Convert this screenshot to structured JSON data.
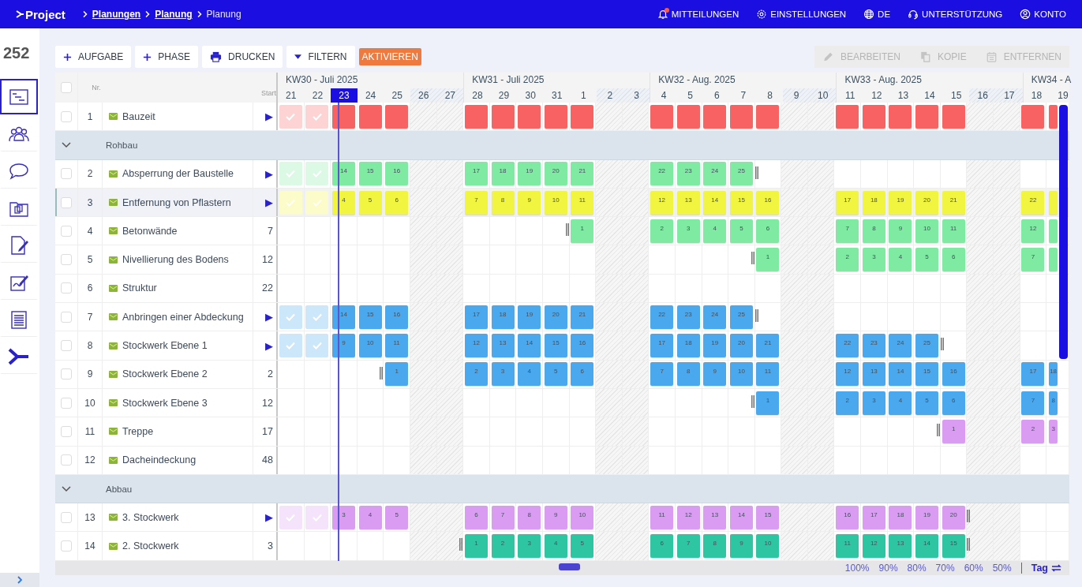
{
  "topbar": {
    "logo": "Project",
    "breadcrumbs": [
      {
        "label": "Planungen",
        "current": false
      },
      {
        "label": "Planung",
        "current": false
      },
      {
        "label": "Planung",
        "current": true
      }
    ],
    "nav": [
      {
        "kind": "notifications",
        "label": "MITTEILUNGEN",
        "unread": true
      },
      {
        "kind": "settings",
        "label": "EINSTELLUNGEN"
      },
      {
        "kind": "language",
        "label": "DE"
      },
      {
        "kind": "support",
        "label": "UNTERSTÜTZUNG"
      },
      {
        "kind": "account",
        "label": "KONTO"
      }
    ]
  },
  "sidebar": {
    "count": "252",
    "items": [
      {
        "selected": true
      },
      {
        "selected": false
      },
      {
        "selected": false
      },
      {
        "selected": false
      },
      {
        "selected": false
      },
      {
        "selected": false
      },
      {
        "selected": false
      },
      {
        "selected": false
      }
    ]
  },
  "toolbar": {
    "left": [
      {
        "kind": "add",
        "label": "AUFGABE",
        "disabled": false
      },
      {
        "kind": "add",
        "label": "PHASE",
        "disabled": false
      },
      {
        "kind": "print",
        "label": "DRUCKEN",
        "disabled": false
      },
      {
        "kind": "filter",
        "label": "FILTERN",
        "disabled": false
      },
      {
        "kind": "accent",
        "label": "AKTIVIEREN",
        "disabled": false
      }
    ],
    "right": [
      {
        "kind": "edit",
        "label": "BEARBEITEN",
        "disabled": true
      },
      {
        "kind": "copy",
        "label": "KOPIE",
        "disabled": true
      },
      {
        "kind": "delete",
        "label": "ENTFERNEN",
        "disabled": true
      }
    ]
  },
  "table": {
    "header": {
      "checked": false,
      "nr": "Nr.",
      "start": "Start"
    },
    "weeks": [
      {
        "label": "KW30 - Juli 2025",
        "days": [
          {
            "label": "21",
            "weekend": false,
            "selected": false
          },
          {
            "label": "22",
            "weekend": false,
            "selected": false
          },
          {
            "label": "23",
            "weekend": false,
            "selected": true
          },
          {
            "label": "24",
            "weekend": false,
            "selected": false
          },
          {
            "label": "25",
            "weekend": false,
            "selected": false
          },
          {
            "label": "26",
            "weekend": true,
            "selected": false
          },
          {
            "label": "27",
            "weekend": true,
            "selected": false
          }
        ]
      },
      {
        "label": "KW31 - Juli 2025",
        "days": [
          {
            "label": "28",
            "weekend": false,
            "selected": false
          },
          {
            "label": "29",
            "weekend": false,
            "selected": false
          },
          {
            "label": "30",
            "weekend": false,
            "selected": false
          },
          {
            "label": "31",
            "weekend": false,
            "selected": false
          },
          {
            "label": "1",
            "weekend": false,
            "selected": false
          },
          {
            "label": "2",
            "weekend": true,
            "selected": false
          },
          {
            "label": "3",
            "weekend": true,
            "selected": false
          }
        ]
      },
      {
        "label": "KW32 - Aug. 2025",
        "days": [
          {
            "label": "4",
            "weekend": false,
            "selected": false
          },
          {
            "label": "5",
            "weekend": false,
            "selected": false
          },
          {
            "label": "6",
            "weekend": false,
            "selected": false
          },
          {
            "label": "7",
            "weekend": false,
            "selected": false
          },
          {
            "label": "8",
            "weekend": false,
            "selected": false
          },
          {
            "label": "9",
            "weekend": true,
            "selected": false
          },
          {
            "label": "10",
            "weekend": true,
            "selected": false
          }
        ]
      },
      {
        "label": "KW33 - Aug. 2025",
        "days": [
          {
            "label": "11",
            "weekend": false,
            "selected": false
          },
          {
            "label": "12",
            "weekend": false,
            "selected": false
          },
          {
            "label": "13",
            "weekend": false,
            "selected": false
          },
          {
            "label": "14",
            "weekend": false,
            "selected": false
          },
          {
            "label": "15",
            "weekend": false,
            "selected": false
          },
          {
            "label": "16",
            "weekend": true,
            "selected": false
          },
          {
            "label": "17",
            "weekend": true,
            "selected": false
          }
        ]
      },
      {
        "label": "KW34 - A",
        "days": [
          {
            "label": "18",
            "weekend": false,
            "selected": false
          },
          {
            "label": "19",
            "weekend": false,
            "selected": false
          }
        ]
      }
    ],
    "rows": [
      {
        "kind": "task",
        "nr": "1",
        "name": "Bauzeit",
        "start": "▶",
        "checked": false,
        "selected": false,
        "color": "#f86262",
        "cells": [
          {
            "kind": "done"
          },
          {
            "kind": "done"
          },
          {
            "kind": "bar"
          },
          {
            "kind": "bar"
          },
          {
            "kind": "bar"
          },
          {
            "kind": "empty"
          },
          {
            "kind": "empty"
          },
          {
            "kind": "bar"
          },
          {
            "kind": "bar"
          },
          {
            "kind": "bar"
          },
          {
            "kind": "bar"
          },
          {
            "kind": "bar"
          },
          {
            "kind": "empty"
          },
          {
            "kind": "empty"
          },
          {
            "kind": "bar"
          },
          {
            "kind": "bar"
          },
          {
            "kind": "bar"
          },
          {
            "kind": "bar"
          },
          {
            "kind": "bar"
          },
          {
            "kind": "empty"
          },
          {
            "kind": "empty"
          },
          {
            "kind": "bar"
          },
          {
            "kind": "bar"
          },
          {
            "kind": "bar"
          },
          {
            "kind": "bar"
          },
          {
            "kind": "bar"
          },
          {
            "kind": "empty"
          },
          {
            "kind": "empty"
          },
          {
            "kind": "bar"
          },
          {
            "kind": "bar"
          }
        ]
      },
      {
        "kind": "group",
        "label": "Rohbau",
        "expanded": true
      },
      {
        "kind": "task",
        "nr": "2",
        "name": "Absperrung der Baustelle",
        "start": "▶",
        "checked": false,
        "selected": false,
        "color": "#7eeaa2",
        "cells": [
          {
            "kind": "done"
          },
          {
            "kind": "done"
          },
          {
            "kind": "bar",
            "label": "14"
          },
          {
            "kind": "bar",
            "label": "15"
          },
          {
            "kind": "bar",
            "label": "16"
          },
          {
            "kind": "empty"
          },
          {
            "kind": "empty"
          },
          {
            "kind": "bar",
            "label": "17"
          },
          {
            "kind": "bar",
            "label": "18"
          },
          {
            "kind": "bar",
            "label": "19"
          },
          {
            "kind": "bar",
            "label": "20"
          },
          {
            "kind": "bar",
            "label": "21"
          },
          {
            "kind": "empty"
          },
          {
            "kind": "empty"
          },
          {
            "kind": "bar",
            "label": "22"
          },
          {
            "kind": "bar",
            "label": "23"
          },
          {
            "kind": "bar",
            "label": "24"
          },
          {
            "kind": "bar",
            "label": "25"
          },
          {
            "kind": "hold"
          },
          {
            "kind": "empty"
          },
          {
            "kind": "empty"
          },
          {
            "kind": "empty"
          },
          {
            "kind": "empty"
          },
          {
            "kind": "empty"
          },
          {
            "kind": "empty"
          },
          {
            "kind": "empty"
          },
          {
            "kind": "empty"
          },
          {
            "kind": "empty"
          },
          {
            "kind": "empty"
          },
          {
            "kind": "empty"
          }
        ]
      },
      {
        "kind": "task",
        "nr": "3",
        "name": "Entfernung von Pflastern",
        "start": "▶",
        "checked": false,
        "selected": true,
        "color": "#f2f53f",
        "cells": [
          {
            "kind": "done"
          },
          {
            "kind": "done"
          },
          {
            "kind": "bar",
            "label": "4"
          },
          {
            "kind": "bar",
            "label": "5"
          },
          {
            "kind": "bar",
            "label": "6"
          },
          {
            "kind": "empty"
          },
          {
            "kind": "empty"
          },
          {
            "kind": "bar",
            "label": "7"
          },
          {
            "kind": "bar",
            "label": "8"
          },
          {
            "kind": "bar",
            "label": "9"
          },
          {
            "kind": "bar",
            "label": "10"
          },
          {
            "kind": "bar",
            "label": "11"
          },
          {
            "kind": "empty"
          },
          {
            "kind": "empty"
          },
          {
            "kind": "bar",
            "label": "12"
          },
          {
            "kind": "bar",
            "label": "13"
          },
          {
            "kind": "bar",
            "label": "14"
          },
          {
            "kind": "bar",
            "label": "15"
          },
          {
            "kind": "bar",
            "label": "16"
          },
          {
            "kind": "empty"
          },
          {
            "kind": "empty"
          },
          {
            "kind": "bar",
            "label": "17"
          },
          {
            "kind": "bar",
            "label": "18"
          },
          {
            "kind": "bar",
            "label": "19"
          },
          {
            "kind": "bar",
            "label": "20"
          },
          {
            "kind": "bar",
            "label": "21"
          },
          {
            "kind": "empty"
          },
          {
            "kind": "empty"
          },
          {
            "kind": "bar",
            "label": "22"
          },
          {
            "kind": "bar"
          }
        ]
      },
      {
        "kind": "task",
        "nr": "4",
        "name": "Betonwände",
        "start": "7",
        "checked": false,
        "selected": false,
        "color": "#7eeaa2",
        "cells": [
          {
            "kind": "empty"
          },
          {
            "kind": "empty"
          },
          {
            "kind": "empty"
          },
          {
            "kind": "empty"
          },
          {
            "kind": "empty"
          },
          {
            "kind": "empty"
          },
          {
            "kind": "empty"
          },
          {
            "kind": "empty"
          },
          {
            "kind": "empty"
          },
          {
            "kind": "empty"
          },
          {
            "kind": "hold"
          },
          {
            "kind": "bar",
            "label": "1"
          },
          {
            "kind": "empty"
          },
          {
            "kind": "empty"
          },
          {
            "kind": "bar",
            "label": "2"
          },
          {
            "kind": "bar",
            "label": "3"
          },
          {
            "kind": "bar",
            "label": "4"
          },
          {
            "kind": "bar",
            "label": "5"
          },
          {
            "kind": "bar",
            "label": "6"
          },
          {
            "kind": "empty"
          },
          {
            "kind": "empty"
          },
          {
            "kind": "bar",
            "label": "7"
          },
          {
            "kind": "bar",
            "label": "8"
          },
          {
            "kind": "bar",
            "label": "9"
          },
          {
            "kind": "bar",
            "label": "10"
          },
          {
            "kind": "bar",
            "label": "11"
          },
          {
            "kind": "empty"
          },
          {
            "kind": "empty"
          },
          {
            "kind": "bar",
            "label": "12"
          },
          {
            "kind": "bar"
          }
        ]
      },
      {
        "kind": "task",
        "nr": "5",
        "name": "Nivellierung des Bodens",
        "start": "12",
        "checked": false,
        "selected": false,
        "color": "#7eeaa2",
        "cells": [
          {
            "kind": "empty"
          },
          {
            "kind": "empty"
          },
          {
            "kind": "empty"
          },
          {
            "kind": "empty"
          },
          {
            "kind": "empty"
          },
          {
            "kind": "empty"
          },
          {
            "kind": "empty"
          },
          {
            "kind": "empty"
          },
          {
            "kind": "empty"
          },
          {
            "kind": "empty"
          },
          {
            "kind": "empty"
          },
          {
            "kind": "empty"
          },
          {
            "kind": "empty"
          },
          {
            "kind": "empty"
          },
          {
            "kind": "empty"
          },
          {
            "kind": "empty"
          },
          {
            "kind": "empty"
          },
          {
            "kind": "hold"
          },
          {
            "kind": "bar",
            "label": "1"
          },
          {
            "kind": "empty"
          },
          {
            "kind": "empty"
          },
          {
            "kind": "bar",
            "label": "2"
          },
          {
            "kind": "bar",
            "label": "3"
          },
          {
            "kind": "bar",
            "label": "4"
          },
          {
            "kind": "bar",
            "label": "5"
          },
          {
            "kind": "bar",
            "label": "6"
          },
          {
            "kind": "empty"
          },
          {
            "kind": "empty"
          },
          {
            "kind": "bar",
            "label": "7"
          },
          {
            "kind": "bar"
          }
        ]
      },
      {
        "kind": "task",
        "nr": "6",
        "name": "Struktur",
        "start": "22",
        "checked": false,
        "selected": false,
        "cells": [
          {
            "kind": "empty"
          },
          {
            "kind": "empty"
          },
          {
            "kind": "empty"
          },
          {
            "kind": "empty"
          },
          {
            "kind": "empty"
          },
          {
            "kind": "empty"
          },
          {
            "kind": "empty"
          },
          {
            "kind": "empty"
          },
          {
            "kind": "empty"
          },
          {
            "kind": "empty"
          },
          {
            "kind": "empty"
          },
          {
            "kind": "empty"
          },
          {
            "kind": "empty"
          },
          {
            "kind": "empty"
          },
          {
            "kind": "empty"
          },
          {
            "kind": "empty"
          },
          {
            "kind": "empty"
          },
          {
            "kind": "empty"
          },
          {
            "kind": "empty"
          },
          {
            "kind": "empty"
          },
          {
            "kind": "empty"
          },
          {
            "kind": "empty"
          },
          {
            "kind": "empty"
          },
          {
            "kind": "empty"
          },
          {
            "kind": "empty"
          },
          {
            "kind": "empty"
          },
          {
            "kind": "empty"
          },
          {
            "kind": "empty"
          },
          {
            "kind": "empty"
          },
          {
            "kind": "empty"
          }
        ]
      },
      {
        "kind": "task",
        "nr": "7",
        "name": "Anbringen einer Abdeckung",
        "start": "▶",
        "checked": false,
        "selected": false,
        "color": "#4aa9ee",
        "cells": [
          {
            "kind": "done"
          },
          {
            "kind": "done"
          },
          {
            "kind": "bar",
            "label": "14"
          },
          {
            "kind": "bar",
            "label": "15"
          },
          {
            "kind": "bar",
            "label": "16"
          },
          {
            "kind": "empty"
          },
          {
            "kind": "empty"
          },
          {
            "kind": "bar",
            "label": "17"
          },
          {
            "kind": "bar",
            "label": "18"
          },
          {
            "kind": "bar",
            "label": "19"
          },
          {
            "kind": "bar",
            "label": "20"
          },
          {
            "kind": "bar",
            "label": "21"
          },
          {
            "kind": "empty"
          },
          {
            "kind": "empty"
          },
          {
            "kind": "bar",
            "label": "22"
          },
          {
            "kind": "bar",
            "label": "23"
          },
          {
            "kind": "bar",
            "label": "24"
          },
          {
            "kind": "bar",
            "label": "25"
          },
          {
            "kind": "hold"
          },
          {
            "kind": "empty"
          },
          {
            "kind": "empty"
          },
          {
            "kind": "empty"
          },
          {
            "kind": "empty"
          },
          {
            "kind": "empty"
          },
          {
            "kind": "empty"
          },
          {
            "kind": "empty"
          },
          {
            "kind": "empty"
          },
          {
            "kind": "empty"
          },
          {
            "kind": "empty"
          },
          {
            "kind": "empty"
          }
        ]
      },
      {
        "kind": "task",
        "nr": "8",
        "name": "Stockwerk Ebene 1",
        "start": "▶",
        "checked": false,
        "selected": false,
        "color": "#4aa9ee",
        "cells": [
          {
            "kind": "done"
          },
          {
            "kind": "done"
          },
          {
            "kind": "bar",
            "label": "9"
          },
          {
            "kind": "bar",
            "label": "10"
          },
          {
            "kind": "bar",
            "label": "11"
          },
          {
            "kind": "empty"
          },
          {
            "kind": "empty"
          },
          {
            "kind": "bar",
            "label": "12"
          },
          {
            "kind": "bar",
            "label": "13"
          },
          {
            "kind": "bar",
            "label": "14"
          },
          {
            "kind": "bar",
            "label": "15"
          },
          {
            "kind": "bar",
            "label": "16"
          },
          {
            "kind": "empty"
          },
          {
            "kind": "empty"
          },
          {
            "kind": "bar",
            "label": "17"
          },
          {
            "kind": "bar",
            "label": "18"
          },
          {
            "kind": "bar",
            "label": "19"
          },
          {
            "kind": "bar",
            "label": "20"
          },
          {
            "kind": "bar",
            "label": "21"
          },
          {
            "kind": "empty"
          },
          {
            "kind": "empty"
          },
          {
            "kind": "bar",
            "label": "22"
          },
          {
            "kind": "bar",
            "label": "23"
          },
          {
            "kind": "bar",
            "label": "24"
          },
          {
            "kind": "bar",
            "label": "25"
          },
          {
            "kind": "hold"
          },
          {
            "kind": "empty"
          },
          {
            "kind": "empty"
          },
          {
            "kind": "empty"
          },
          {
            "kind": "empty"
          }
        ]
      },
      {
        "kind": "task",
        "nr": "9",
        "name": "Stockwerk Ebene 2",
        "start": "2",
        "checked": false,
        "selected": false,
        "color": "#4aa9ee",
        "cells": [
          {
            "kind": "empty"
          },
          {
            "kind": "empty"
          },
          {
            "kind": "empty"
          },
          {
            "kind": "hold"
          },
          {
            "kind": "bar",
            "label": "1"
          },
          {
            "kind": "empty"
          },
          {
            "kind": "empty"
          },
          {
            "kind": "bar",
            "label": "2"
          },
          {
            "kind": "bar",
            "label": "3"
          },
          {
            "kind": "bar",
            "label": "4"
          },
          {
            "kind": "bar",
            "label": "5"
          },
          {
            "kind": "bar",
            "label": "6"
          },
          {
            "kind": "empty"
          },
          {
            "kind": "empty"
          },
          {
            "kind": "bar",
            "label": "7"
          },
          {
            "kind": "bar",
            "label": "8"
          },
          {
            "kind": "bar",
            "label": "9"
          },
          {
            "kind": "bar",
            "label": "10"
          },
          {
            "kind": "bar",
            "label": "11"
          },
          {
            "kind": "empty"
          },
          {
            "kind": "empty"
          },
          {
            "kind": "bar",
            "label": "12"
          },
          {
            "kind": "bar",
            "label": "13"
          },
          {
            "kind": "bar",
            "label": "14"
          },
          {
            "kind": "bar",
            "label": "15"
          },
          {
            "kind": "bar",
            "label": "16"
          },
          {
            "kind": "empty"
          },
          {
            "kind": "empty"
          },
          {
            "kind": "bar",
            "label": "17"
          },
          {
            "kind": "bar",
            "label": "18"
          }
        ]
      },
      {
        "kind": "task",
        "nr": "10",
        "name": "Stockwerk Ebene 3",
        "start": "12",
        "checked": false,
        "selected": false,
        "color": "#4aa9ee",
        "cells": [
          {
            "kind": "empty"
          },
          {
            "kind": "empty"
          },
          {
            "kind": "empty"
          },
          {
            "kind": "empty"
          },
          {
            "kind": "empty"
          },
          {
            "kind": "empty"
          },
          {
            "kind": "empty"
          },
          {
            "kind": "empty"
          },
          {
            "kind": "empty"
          },
          {
            "kind": "empty"
          },
          {
            "kind": "empty"
          },
          {
            "kind": "empty"
          },
          {
            "kind": "empty"
          },
          {
            "kind": "empty"
          },
          {
            "kind": "empty"
          },
          {
            "kind": "empty"
          },
          {
            "kind": "empty"
          },
          {
            "kind": "hold"
          },
          {
            "kind": "bar",
            "label": "1"
          },
          {
            "kind": "empty"
          },
          {
            "kind": "empty"
          },
          {
            "kind": "bar",
            "label": "2"
          },
          {
            "kind": "bar",
            "label": "3"
          },
          {
            "kind": "bar",
            "label": "4"
          },
          {
            "kind": "bar",
            "label": "5"
          },
          {
            "kind": "bar",
            "label": "6"
          },
          {
            "kind": "empty"
          },
          {
            "kind": "empty"
          },
          {
            "kind": "bar",
            "label": "7"
          },
          {
            "kind": "bar",
            "label": "8"
          }
        ]
      },
      {
        "kind": "task",
        "nr": "11",
        "name": "Treppe",
        "start": "17",
        "checked": false,
        "selected": false,
        "color": "#da9cf2",
        "cells": [
          {
            "kind": "empty"
          },
          {
            "kind": "empty"
          },
          {
            "kind": "empty"
          },
          {
            "kind": "empty"
          },
          {
            "kind": "empty"
          },
          {
            "kind": "empty"
          },
          {
            "kind": "empty"
          },
          {
            "kind": "empty"
          },
          {
            "kind": "empty"
          },
          {
            "kind": "empty"
          },
          {
            "kind": "empty"
          },
          {
            "kind": "empty"
          },
          {
            "kind": "empty"
          },
          {
            "kind": "empty"
          },
          {
            "kind": "empty"
          },
          {
            "kind": "empty"
          },
          {
            "kind": "empty"
          },
          {
            "kind": "empty"
          },
          {
            "kind": "empty"
          },
          {
            "kind": "empty"
          },
          {
            "kind": "empty"
          },
          {
            "kind": "empty"
          },
          {
            "kind": "empty"
          },
          {
            "kind": "empty"
          },
          {
            "kind": "hold"
          },
          {
            "kind": "bar",
            "label": "1"
          },
          {
            "kind": "empty"
          },
          {
            "kind": "empty"
          },
          {
            "kind": "bar",
            "label": "2"
          },
          {
            "kind": "bar",
            "label": "3"
          }
        ]
      },
      {
        "kind": "task",
        "nr": "12",
        "name": "Dacheindeckung",
        "start": "48",
        "checked": false,
        "selected": false,
        "cells": [
          {
            "kind": "empty"
          },
          {
            "kind": "empty"
          },
          {
            "kind": "empty"
          },
          {
            "kind": "empty"
          },
          {
            "kind": "empty"
          },
          {
            "kind": "empty"
          },
          {
            "kind": "empty"
          },
          {
            "kind": "empty"
          },
          {
            "kind": "empty"
          },
          {
            "kind": "empty"
          },
          {
            "kind": "empty"
          },
          {
            "kind": "empty"
          },
          {
            "kind": "empty"
          },
          {
            "kind": "empty"
          },
          {
            "kind": "empty"
          },
          {
            "kind": "empty"
          },
          {
            "kind": "empty"
          },
          {
            "kind": "empty"
          },
          {
            "kind": "empty"
          },
          {
            "kind": "empty"
          },
          {
            "kind": "empty"
          },
          {
            "kind": "empty"
          },
          {
            "kind": "empty"
          },
          {
            "kind": "empty"
          },
          {
            "kind": "empty"
          },
          {
            "kind": "empty"
          },
          {
            "kind": "empty"
          },
          {
            "kind": "empty"
          },
          {
            "kind": "empty"
          },
          {
            "kind": "empty"
          }
        ]
      },
      {
        "kind": "group",
        "label": "Abbau",
        "expanded": true
      },
      {
        "kind": "task",
        "nr": "13",
        "name": "3. Stockwerk",
        "start": "▶",
        "checked": false,
        "selected": false,
        "color": "#da9cf2",
        "cells": [
          {
            "kind": "done"
          },
          {
            "kind": "done"
          },
          {
            "kind": "bar",
            "label": "3"
          },
          {
            "kind": "bar",
            "label": "4"
          },
          {
            "kind": "bar",
            "label": "5"
          },
          {
            "kind": "empty"
          },
          {
            "kind": "empty"
          },
          {
            "kind": "bar",
            "label": "6"
          },
          {
            "kind": "bar",
            "label": "7"
          },
          {
            "kind": "bar",
            "label": "8"
          },
          {
            "kind": "bar",
            "label": "9"
          },
          {
            "kind": "bar",
            "label": "10"
          },
          {
            "kind": "empty"
          },
          {
            "kind": "empty"
          },
          {
            "kind": "bar",
            "label": "11"
          },
          {
            "kind": "bar",
            "label": "12"
          },
          {
            "kind": "bar",
            "label": "13"
          },
          {
            "kind": "bar",
            "label": "14"
          },
          {
            "kind": "bar",
            "label": "15"
          },
          {
            "kind": "empty"
          },
          {
            "kind": "empty"
          },
          {
            "kind": "bar",
            "label": "16"
          },
          {
            "kind": "bar",
            "label": "17"
          },
          {
            "kind": "bar",
            "label": "18"
          },
          {
            "kind": "bar",
            "label": "19"
          },
          {
            "kind": "bar",
            "label": "20"
          },
          {
            "kind": "hold"
          },
          {
            "kind": "empty"
          },
          {
            "kind": "empty"
          },
          {
            "kind": "empty"
          }
        ]
      },
      {
        "kind": "task",
        "nr": "14",
        "name": "2. Stockwerk",
        "start": "3",
        "checked": false,
        "selected": false,
        "color": "#2ec6a2",
        "cells": [
          {
            "kind": "empty"
          },
          {
            "kind": "empty"
          },
          {
            "kind": "empty"
          },
          {
            "kind": "empty"
          },
          {
            "kind": "empty"
          },
          {
            "kind": "empty"
          },
          {
            "kind": "hold"
          },
          {
            "kind": "bar",
            "label": "1"
          },
          {
            "kind": "bar",
            "label": "2"
          },
          {
            "kind": "bar",
            "label": "3"
          },
          {
            "kind": "bar",
            "label": "4"
          },
          {
            "kind": "bar",
            "label": "5"
          },
          {
            "kind": "empty"
          },
          {
            "kind": "empty"
          },
          {
            "kind": "bar",
            "label": "6"
          },
          {
            "kind": "bar",
            "label": "7"
          },
          {
            "kind": "bar",
            "label": "8"
          },
          {
            "kind": "bar",
            "label": "9"
          },
          {
            "kind": "bar",
            "label": "10"
          },
          {
            "kind": "empty"
          },
          {
            "kind": "empty"
          },
          {
            "kind": "bar",
            "label": "11"
          },
          {
            "kind": "bar",
            "label": "12"
          },
          {
            "kind": "bar",
            "label": "13"
          },
          {
            "kind": "bar",
            "label": "14"
          },
          {
            "kind": "bar",
            "label": "15"
          },
          {
            "kind": "hold"
          },
          {
            "kind": "empty"
          },
          {
            "kind": "empty"
          },
          {
            "kind": "empty"
          }
        ]
      }
    ]
  },
  "footer": {
    "zoom_levels": [
      "100%",
      "90%",
      "80%",
      "70%",
      "60%",
      "50%"
    ],
    "mode": "Tag"
  }
}
